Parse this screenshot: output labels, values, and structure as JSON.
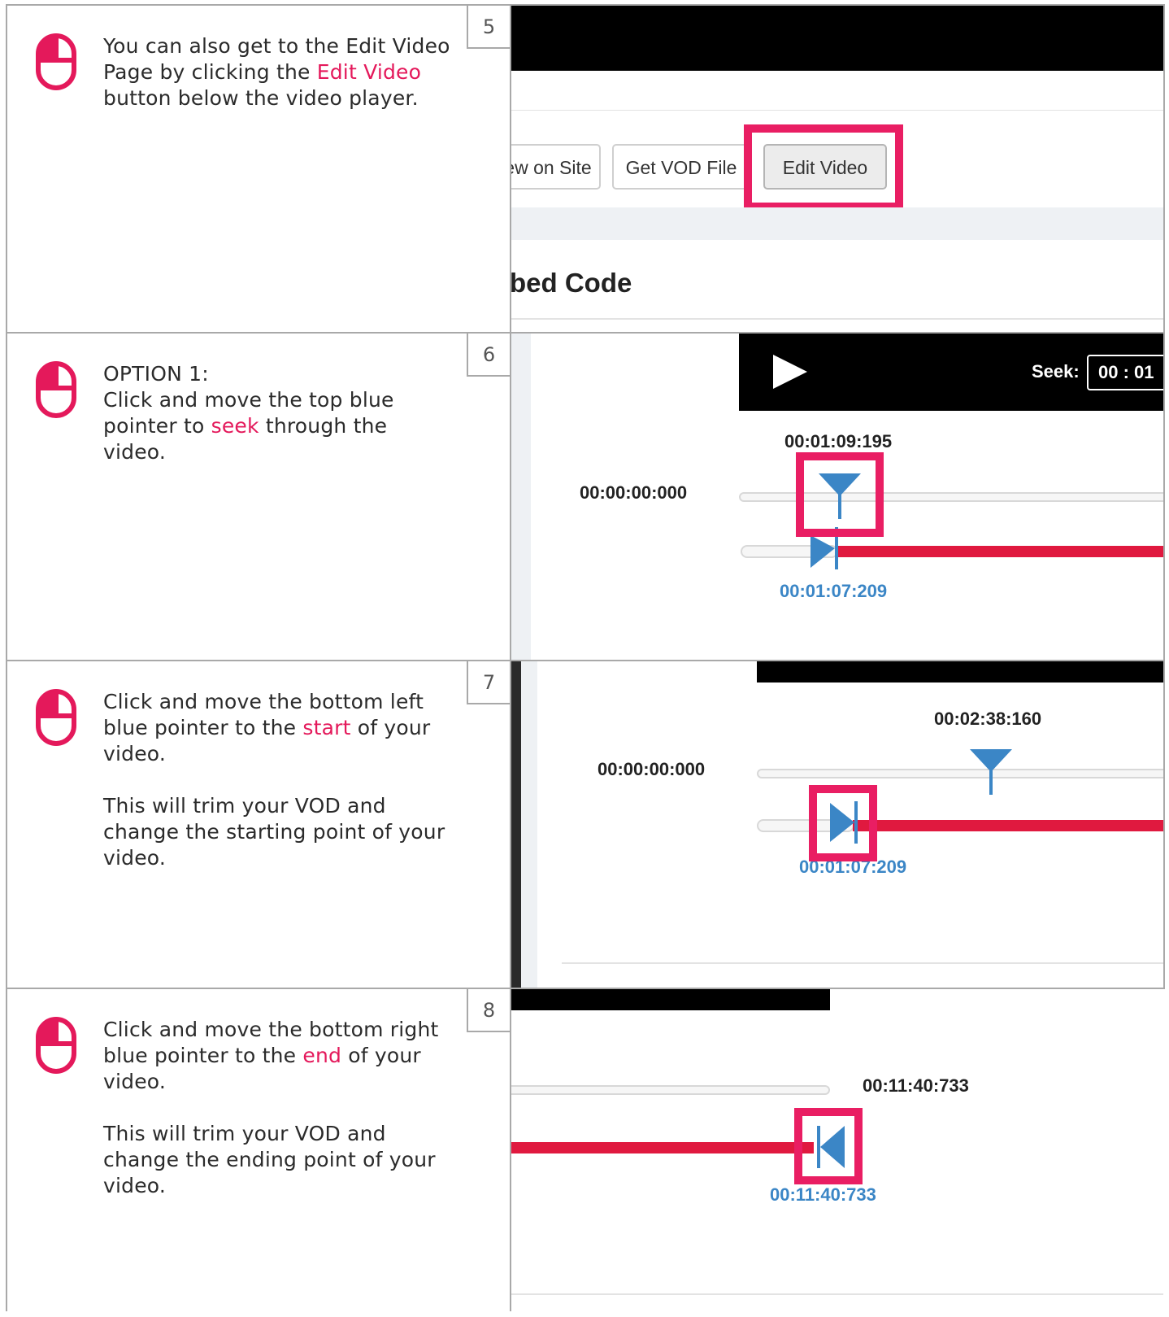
{
  "colors": {
    "accent": "#e4195b",
    "highlight_box": "#e91e63",
    "trim_bar": "#e0193f",
    "pointer_blue": "#3b86c6"
  },
  "steps": [
    {
      "number": "5",
      "icon": "mouse-left-click-icon",
      "text": {
        "pre": "You can also get to the Edit Video Page by clicking the ",
        "highlight": "Edit Video",
        "post": " button below the video player."
      },
      "screenshot": {
        "buttons": [
          "ew on Site",
          "Get VOD File",
          "Edit Video"
        ],
        "active_button": "Edit Video",
        "section_title": "bed Code"
      }
    },
    {
      "number": "6",
      "icon": "mouse-left-click-icon",
      "text": {
        "line1": "OPTION 1:",
        "pre": "Click and move the top blue pointer to ",
        "highlight": "seek",
        "post": " through the video."
      },
      "screenshot": {
        "seek_label": "Seek:",
        "seek_value": "00 : 01",
        "seek_time": "00:01:09:195",
        "start_time": "00:00:00:000",
        "trim_start_time": "00:01:07:209"
      }
    },
    {
      "number": "7",
      "icon": "mouse-left-click-icon",
      "text": {
        "pre": "Click and move the bottom left blue pointer to the ",
        "highlight": "start",
        "post": " of your video.",
        "para2": "This will trim your VOD and change the starting point of your video."
      },
      "screenshot": {
        "seek_time": "00:02:38:160",
        "start_time": "00:00:00:000",
        "trim_start_time": "00:01:07:209"
      }
    },
    {
      "number": "8",
      "icon": "mouse-left-click-icon",
      "text": {
        "pre": "Click and move the bottom right blue pointer to the ",
        "highlight": "end",
        "post": " of your video.",
        "para2": "This will trim your VOD and change the ending point of your video."
      },
      "screenshot": {
        "end_time": "00:11:40:733",
        "trim_end_time": "00:11:40:733"
      }
    }
  ]
}
